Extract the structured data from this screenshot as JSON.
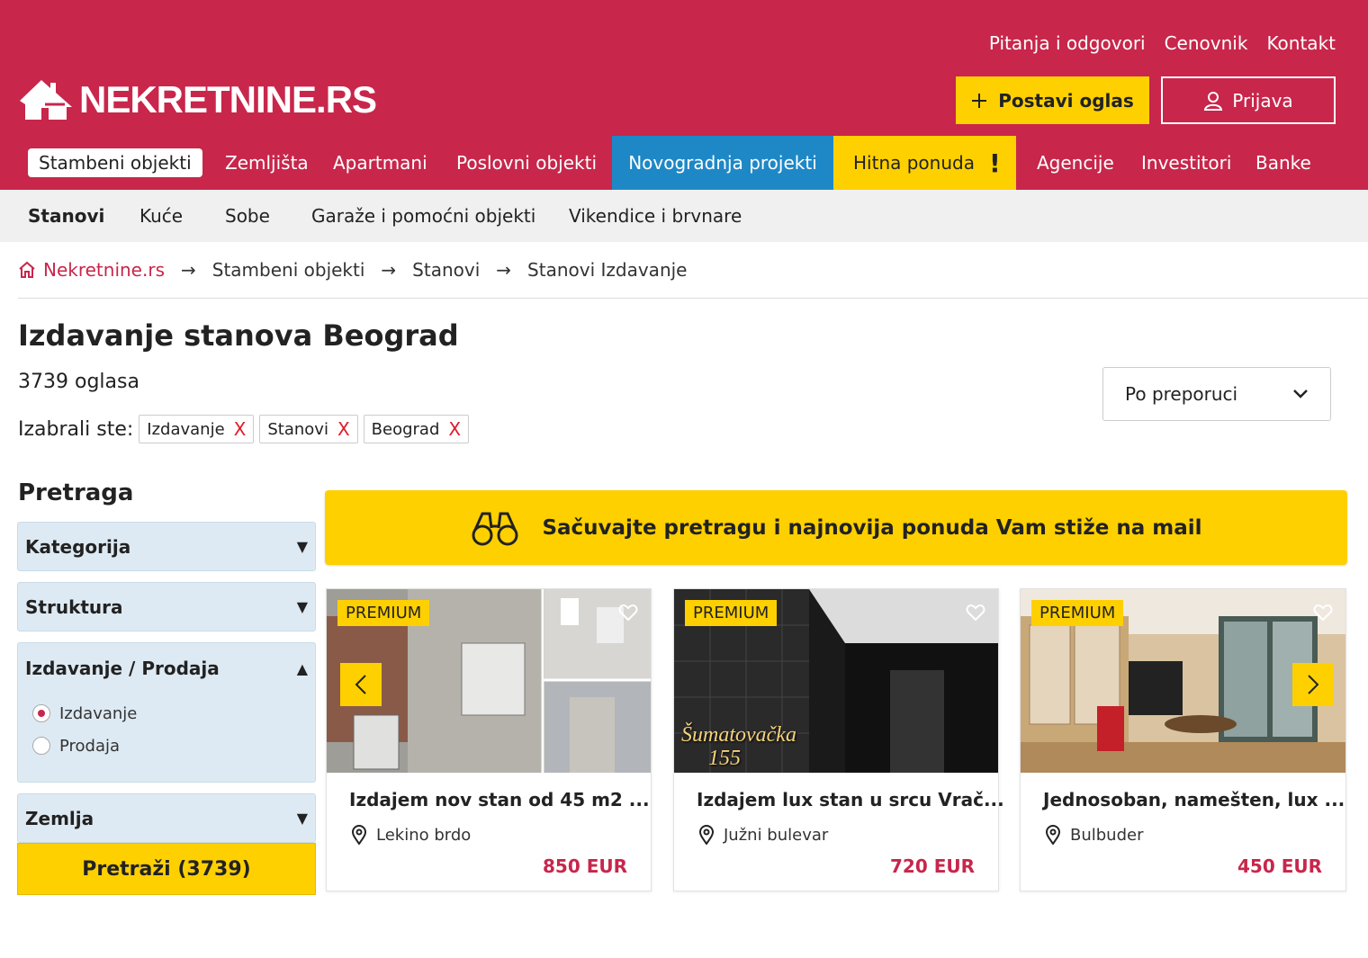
{
  "colors": {
    "brand": "#c8264b",
    "accent_yellow": "#ffd000",
    "novogradnja_blue": "#1e88c7",
    "price": "#c8264b"
  },
  "header": {
    "top_links": [
      "Pitanja i odgovori",
      "Cenovnik",
      "Kontakt"
    ],
    "logo_text": "NEKRETNINE.RS",
    "post_ad": "Postavi oglas",
    "login": "Prijava"
  },
  "main_nav": {
    "items": [
      "Stambeni objekti",
      "Zemljišta",
      "Apartmani",
      "Poslovni objekti",
      "Novogradnja projekti",
      "Hitna ponuda",
      "Agencije",
      "Investitori",
      "Banke"
    ],
    "urgent_mark": "!"
  },
  "sub_nav": {
    "items": [
      "Stanovi",
      "Kuće",
      "Sobe",
      "Garaže i pomoćni objekti",
      "Vikendice i brvnare"
    ]
  },
  "breadcrumb": {
    "items": [
      "Nekretnine.rs",
      "Stambeni objekti",
      "Stanovi",
      "Stanovi Izdavanje"
    ],
    "separator": "→"
  },
  "page": {
    "title": "Izdavanje stanova Beograd",
    "count": "3739 oglasa",
    "chosen_label": "Izabrali ste:",
    "chips": [
      "Izdavanje",
      "Stanovi",
      "Beograd"
    ],
    "chip_remove": "X",
    "sort": "Po preporuci"
  },
  "sidebar": {
    "title": "Pretraga",
    "sections": [
      "Kategorija",
      "Struktura",
      "Izdavanje / Prodaja",
      "Zemlja"
    ],
    "arrow_down": "▼",
    "arrow_up": "▲",
    "options": [
      "Izdavanje",
      "Prodaja"
    ],
    "selected_option": "Izdavanje",
    "search_button": "Pretraži (3739)"
  },
  "banner": {
    "text": "Sačuvajte pretragu i najnovija ponuda Vam stiže na mail"
  },
  "listings": [
    {
      "badge": "PREMIUM",
      "title": "Izdajem nov stan od 45 m2 ...",
      "location": "Lekino brdo",
      "price": "850 EUR"
    },
    {
      "badge": "PREMIUM",
      "title": "Izdajem lux stan u srcu Vrač...",
      "location": "Južni bulevar",
      "price": "720 EUR",
      "image_text": [
        "Šumatovačka",
        "155"
      ]
    },
    {
      "badge": "PREMIUM",
      "title": "Jednosoban, namešten, lux ...",
      "location": "Bulbuder",
      "price": "450 EUR"
    }
  ]
}
